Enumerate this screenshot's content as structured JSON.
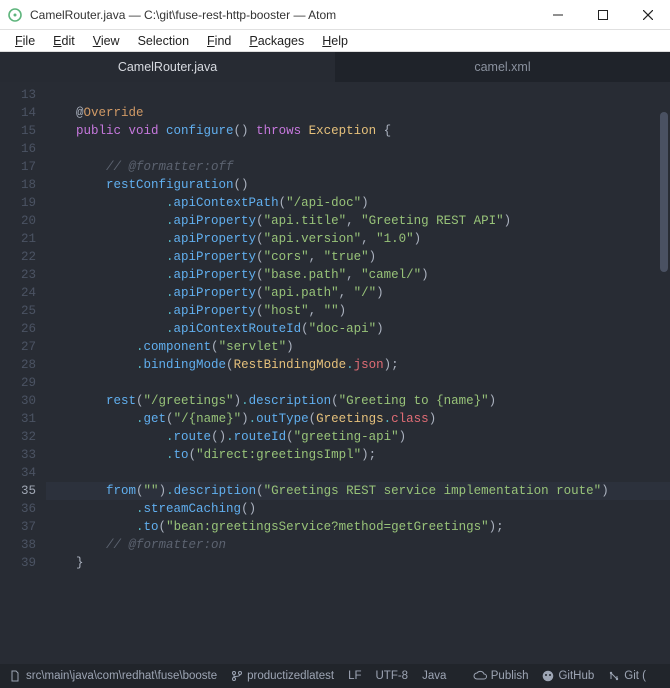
{
  "window": {
    "title": "CamelRouter.java — C:\\git\\fuse-rest-http-booster — Atom",
    "minimize": "—",
    "close": "✕"
  },
  "menu": {
    "file": "File",
    "edit": "Edit",
    "view": "View",
    "selection": "Selection",
    "find": "Find",
    "packages": "Packages",
    "help": "Help"
  },
  "tabs": {
    "active": "CamelRouter.java",
    "inactive": "camel.xml"
  },
  "editor": {
    "line_start": 13,
    "current_line": 35,
    "lines": {
      "13": [],
      "14": [
        {
          "cls": "t-at",
          "t": "    @"
        },
        {
          "cls": "t-or",
          "t": "Override"
        }
      ],
      "15": [
        {
          "cls": "t-key",
          "t": "    public "
        },
        {
          "cls": "t-void",
          "t": "void "
        },
        {
          "cls": "t-fn",
          "t": "configure"
        },
        {
          "cls": "t-punc",
          "t": "() "
        },
        {
          "cls": "t-key",
          "t": "throws "
        },
        {
          "cls": "t-class",
          "t": "Exception "
        },
        {
          "cls": "t-punc",
          "t": "{"
        }
      ],
      "16": [],
      "17": [
        {
          "cls": "t-com",
          "t": "        // @formatter:off"
        }
      ],
      "18": [
        {
          "cls": "t-plain",
          "t": "        "
        },
        {
          "cls": "t-fn",
          "t": "restConfiguration"
        },
        {
          "cls": "t-punc",
          "t": "()"
        }
      ],
      "19": [
        {
          "cls": "t-plain",
          "t": "                "
        },
        {
          "cls": "t-puncd",
          "t": "."
        },
        {
          "cls": "t-fn",
          "t": "apiContextPath"
        },
        {
          "cls": "t-punc",
          "t": "("
        },
        {
          "cls": "t-str",
          "t": "\"/api-doc\""
        },
        {
          "cls": "t-punc",
          "t": ")"
        }
      ],
      "20": [
        {
          "cls": "t-plain",
          "t": "                "
        },
        {
          "cls": "t-puncd",
          "t": "."
        },
        {
          "cls": "t-fn",
          "t": "apiProperty"
        },
        {
          "cls": "t-punc",
          "t": "("
        },
        {
          "cls": "t-str",
          "t": "\"api.title\""
        },
        {
          "cls": "t-punc",
          "t": ", "
        },
        {
          "cls": "t-str",
          "t": "\"Greeting REST API\""
        },
        {
          "cls": "t-punc",
          "t": ")"
        }
      ],
      "21": [
        {
          "cls": "t-plain",
          "t": "                "
        },
        {
          "cls": "t-puncd",
          "t": "."
        },
        {
          "cls": "t-fn",
          "t": "apiProperty"
        },
        {
          "cls": "t-punc",
          "t": "("
        },
        {
          "cls": "t-str",
          "t": "\"api.version\""
        },
        {
          "cls": "t-punc",
          "t": ", "
        },
        {
          "cls": "t-str",
          "t": "\"1.0\""
        },
        {
          "cls": "t-punc",
          "t": ")"
        }
      ],
      "22": [
        {
          "cls": "t-plain",
          "t": "                "
        },
        {
          "cls": "t-puncd",
          "t": "."
        },
        {
          "cls": "t-fn",
          "t": "apiProperty"
        },
        {
          "cls": "t-punc",
          "t": "("
        },
        {
          "cls": "t-str",
          "t": "\"cors\""
        },
        {
          "cls": "t-punc",
          "t": ", "
        },
        {
          "cls": "t-str",
          "t": "\"true\""
        },
        {
          "cls": "t-punc",
          "t": ")"
        }
      ],
      "23": [
        {
          "cls": "t-plain",
          "t": "                "
        },
        {
          "cls": "t-puncd",
          "t": "."
        },
        {
          "cls": "t-fn",
          "t": "apiProperty"
        },
        {
          "cls": "t-punc",
          "t": "("
        },
        {
          "cls": "t-str",
          "t": "\"base.path\""
        },
        {
          "cls": "t-punc",
          "t": ", "
        },
        {
          "cls": "t-str",
          "t": "\"camel/\""
        },
        {
          "cls": "t-punc",
          "t": ")"
        }
      ],
      "24": [
        {
          "cls": "t-plain",
          "t": "                "
        },
        {
          "cls": "t-puncd",
          "t": "."
        },
        {
          "cls": "t-fn",
          "t": "apiProperty"
        },
        {
          "cls": "t-punc",
          "t": "("
        },
        {
          "cls": "t-str",
          "t": "\"api.path\""
        },
        {
          "cls": "t-punc",
          "t": ", "
        },
        {
          "cls": "t-str",
          "t": "\"/\""
        },
        {
          "cls": "t-punc",
          "t": ")"
        }
      ],
      "25": [
        {
          "cls": "t-plain",
          "t": "                "
        },
        {
          "cls": "t-puncd",
          "t": "."
        },
        {
          "cls": "t-fn",
          "t": "apiProperty"
        },
        {
          "cls": "t-punc",
          "t": "("
        },
        {
          "cls": "t-str",
          "t": "\"host\""
        },
        {
          "cls": "t-punc",
          "t": ", "
        },
        {
          "cls": "t-str",
          "t": "\"\""
        },
        {
          "cls": "t-punc",
          "t": ")"
        }
      ],
      "26": [
        {
          "cls": "t-plain",
          "t": "                "
        },
        {
          "cls": "t-puncd",
          "t": "."
        },
        {
          "cls": "t-fn",
          "t": "apiContextRouteId"
        },
        {
          "cls": "t-punc",
          "t": "("
        },
        {
          "cls": "t-str",
          "t": "\"doc-api\""
        },
        {
          "cls": "t-punc",
          "t": ")"
        }
      ],
      "27": [
        {
          "cls": "t-plain",
          "t": "            "
        },
        {
          "cls": "t-puncd",
          "t": "."
        },
        {
          "cls": "t-fn",
          "t": "component"
        },
        {
          "cls": "t-punc",
          "t": "("
        },
        {
          "cls": "t-str",
          "t": "\"servlet\""
        },
        {
          "cls": "t-punc",
          "t": ")"
        }
      ],
      "28": [
        {
          "cls": "t-plain",
          "t": "            "
        },
        {
          "cls": "t-puncd",
          "t": "."
        },
        {
          "cls": "t-fn",
          "t": "bindingMode"
        },
        {
          "cls": "t-punc",
          "t": "("
        },
        {
          "cls": "t-class",
          "t": "RestBindingMode"
        },
        {
          "cls": "t-puncd",
          "t": "."
        },
        {
          "cls": "t-enum",
          "t": "json"
        },
        {
          "cls": "t-punc",
          "t": ");"
        }
      ],
      "29": [],
      "30": [
        {
          "cls": "t-plain",
          "t": "        "
        },
        {
          "cls": "t-fn",
          "t": "rest"
        },
        {
          "cls": "t-punc",
          "t": "("
        },
        {
          "cls": "t-str",
          "t": "\"/greetings\""
        },
        {
          "cls": "t-punc",
          "t": ")"
        },
        {
          "cls": "t-puncd",
          "t": "."
        },
        {
          "cls": "t-fn",
          "t": "description"
        },
        {
          "cls": "t-punc",
          "t": "("
        },
        {
          "cls": "t-str",
          "t": "\"Greeting to {name}\""
        },
        {
          "cls": "t-punc",
          "t": ")"
        }
      ],
      "31": [
        {
          "cls": "t-plain",
          "t": "            "
        },
        {
          "cls": "t-puncd",
          "t": "."
        },
        {
          "cls": "t-fn",
          "t": "get"
        },
        {
          "cls": "t-punc",
          "t": "("
        },
        {
          "cls": "t-str",
          "t": "\"/{name}\""
        },
        {
          "cls": "t-punc",
          "t": ")"
        },
        {
          "cls": "t-puncd",
          "t": "."
        },
        {
          "cls": "t-fn",
          "t": "outType"
        },
        {
          "cls": "t-punc",
          "t": "("
        },
        {
          "cls": "t-class",
          "t": "Greetings"
        },
        {
          "cls": "t-puncd",
          "t": "."
        },
        {
          "cls": "t-enum",
          "t": "class"
        },
        {
          "cls": "t-punc",
          "t": ")"
        }
      ],
      "32": [
        {
          "cls": "t-plain",
          "t": "                "
        },
        {
          "cls": "t-puncd",
          "t": "."
        },
        {
          "cls": "t-fn",
          "t": "route"
        },
        {
          "cls": "t-punc",
          "t": "()"
        },
        {
          "cls": "t-puncd",
          "t": "."
        },
        {
          "cls": "t-fn",
          "t": "routeId"
        },
        {
          "cls": "t-punc",
          "t": "("
        },
        {
          "cls": "t-str",
          "t": "\"greeting-api\""
        },
        {
          "cls": "t-punc",
          "t": ")"
        }
      ],
      "33": [
        {
          "cls": "t-plain",
          "t": "                "
        },
        {
          "cls": "t-puncd",
          "t": "."
        },
        {
          "cls": "t-fn",
          "t": "to"
        },
        {
          "cls": "t-punc",
          "t": "("
        },
        {
          "cls": "t-str",
          "t": "\"direct:greetingsImpl\""
        },
        {
          "cls": "t-punc",
          "t": ");"
        }
      ],
      "34": [],
      "35": [
        {
          "cls": "t-plain",
          "t": "        "
        },
        {
          "cls": "t-fn",
          "t": "from"
        },
        {
          "cls": "t-punc",
          "t": "("
        },
        {
          "cls": "t-str",
          "t": "\"\""
        },
        {
          "cls": "t-punc",
          "t": ")"
        },
        {
          "cls": "t-puncd",
          "t": "."
        },
        {
          "cls": "t-fn",
          "t": "description"
        },
        {
          "cls": "t-punc",
          "t": "("
        },
        {
          "cls": "t-str",
          "t": "\"Greetings REST service implementation route\""
        },
        {
          "cls": "t-punc",
          "t": ")"
        }
      ],
      "36": [
        {
          "cls": "t-plain",
          "t": "            "
        },
        {
          "cls": "t-puncd",
          "t": "."
        },
        {
          "cls": "t-fn",
          "t": "streamCaching"
        },
        {
          "cls": "t-punc",
          "t": "()"
        }
      ],
      "37": [
        {
          "cls": "t-plain",
          "t": "            "
        },
        {
          "cls": "t-puncd",
          "t": "."
        },
        {
          "cls": "t-fn",
          "t": "to"
        },
        {
          "cls": "t-punc",
          "t": "("
        },
        {
          "cls": "t-str",
          "t": "\"bean:greetingsService?method=getGreetings\""
        },
        {
          "cls": "t-punc",
          "t": ");"
        }
      ],
      "38": [
        {
          "cls": "t-com",
          "t": "        // @formatter:on"
        }
      ],
      "39": [
        {
          "cls": "t-punc",
          "t": "    }"
        }
      ]
    }
  },
  "status": {
    "path": "src\\main\\java\\com\\redhat\\fuse\\booste",
    "branch": "productizedlatest",
    "eol": "LF",
    "encoding": "UTF-8",
    "grammar": "Java",
    "publish": "Publish",
    "github": "GitHub",
    "git": "Git ("
  }
}
